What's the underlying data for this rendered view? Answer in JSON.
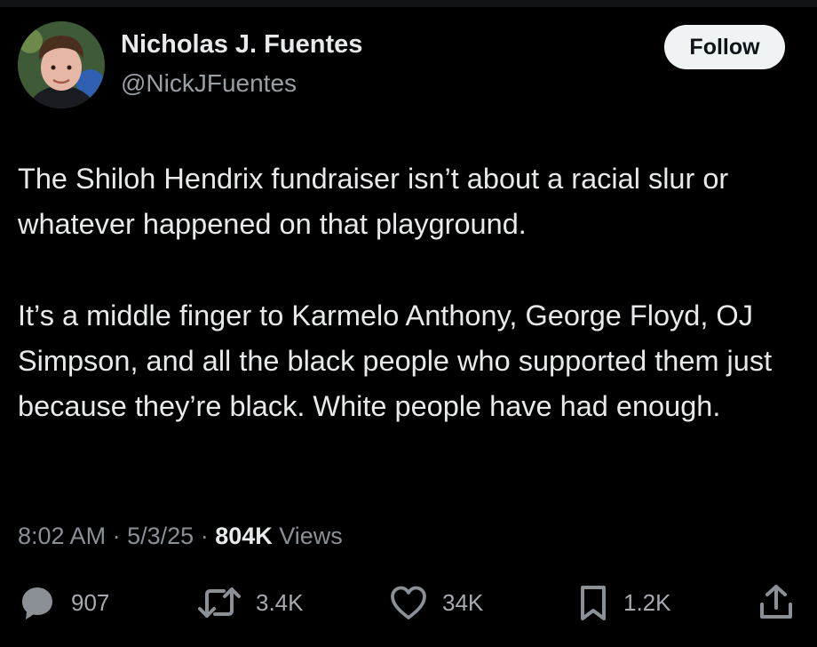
{
  "author": {
    "display_name": "Nicholas J. Fuentes",
    "handle": "@NickJFuentes",
    "avatar_icon": "profile-photo"
  },
  "follow_label": "Follow",
  "tweet": {
    "paragraphs": [
      "The Shiloh Hendrix fundraiser isn’t about a racial slur or whatever happened on that playground.",
      "It’s a middle finger to Karmelo Anthony, George Floyd, OJ Simpson, and all the black people who supported them just because they’re black. White people have had enough."
    ]
  },
  "meta": {
    "time": "8:02 AM",
    "separator": "·",
    "date": "5/3/25",
    "views_count": "804K",
    "views_label": "Views"
  },
  "actions": {
    "replies": "907",
    "reposts": "3.4K",
    "likes": "34K",
    "bookmarks": "1.2K"
  },
  "icons": {
    "reply": "reply-icon",
    "repost": "repost-icon",
    "like": "like-icon",
    "bookmark": "bookmark-icon",
    "share": "share-icon"
  },
  "colors": {
    "background": "#000000",
    "text_primary": "#e7e9ea",
    "text_secondary": "#8b9096",
    "follow_button_bg": "#eff3f4",
    "follow_button_text": "#0f1419"
  }
}
